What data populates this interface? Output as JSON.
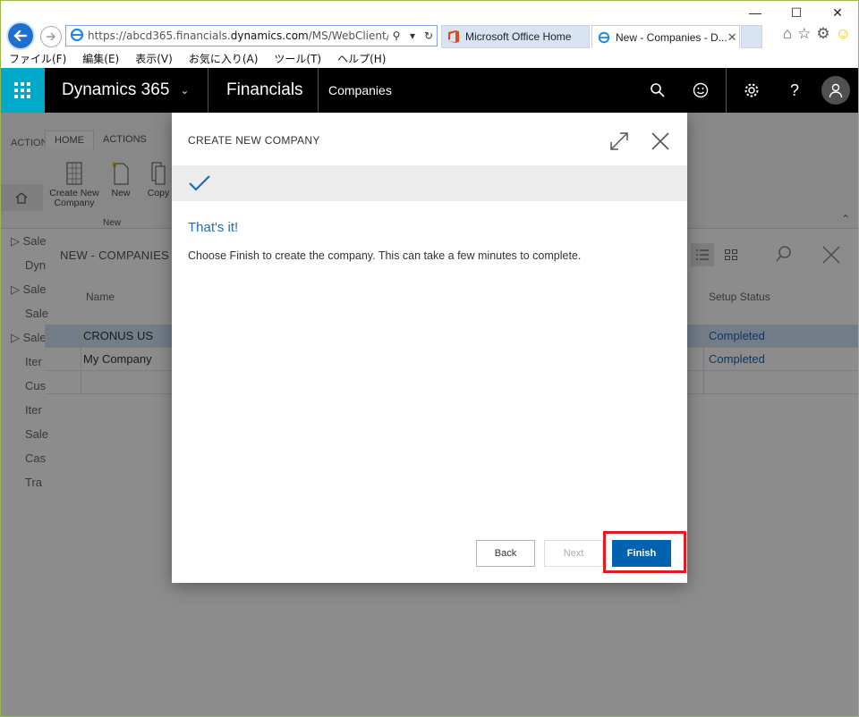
{
  "browser": {
    "window_controls": {
      "minimize": "—",
      "maximize": "☐",
      "close": "✕"
    },
    "address": {
      "url_prefix": "https://abcd365.financials.",
      "url_domain": "dynamics.com",
      "url_suffix": "/MS/WebClient/?aid=F"
    },
    "tabs": [
      {
        "label": "Microsoft Office Home"
      },
      {
        "label": "New - Companies - D...",
        "close": "✕"
      }
    ],
    "menu": [
      "ファイル(F)",
      "編集(E)",
      "表示(V)",
      "お気に入り(A)",
      "ツール(T)",
      "ヘルプ(H)"
    ]
  },
  "header": {
    "brand": "Dynamics 365",
    "app": "Financials",
    "area": "Companies",
    "colors": {
      "waffle_bg": "#00a9c8",
      "bar_bg": "#000000"
    }
  },
  "ribbon": {
    "left_tab": "ACTION",
    "tabs": [
      "HOME",
      "ACTIONS"
    ],
    "buttons": [
      {
        "label_line1": "Create New",
        "label_line2": "Company"
      },
      {
        "label_line1": "New",
        "label_line2": ""
      },
      {
        "label_line1": "Copy",
        "label_line2": ""
      }
    ],
    "group": "New"
  },
  "nav": {
    "items": [
      "Sale",
      "Dyn",
      "Sale",
      "Sale",
      "Sale",
      "Iter",
      "Cus",
      "Iter",
      "Sale",
      "Cas",
      "Tra"
    ]
  },
  "list": {
    "title": "NEW - COMPANIES",
    "columns": {
      "name": "Name",
      "status": "Setup Status"
    },
    "rows": [
      {
        "name": "CRONUS US",
        "status": "Completed"
      },
      {
        "name": "My Company",
        "status": "Completed"
      }
    ]
  },
  "dialog": {
    "title": "CREATE NEW COMPANY",
    "heading": "That's it!",
    "body": "Choose Finish to create the company. This can take a few minutes to complete.",
    "buttons": {
      "back": "Back",
      "next": "Next",
      "finish": "Finish"
    },
    "accent": "#0063b1",
    "highlight_color": "#e11b22"
  }
}
